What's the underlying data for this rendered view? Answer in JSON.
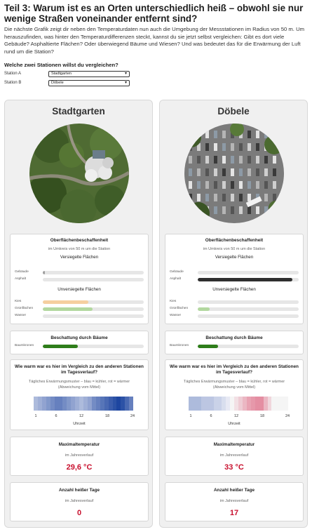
{
  "header": {
    "title": "Teil 3: Warum ist es an Orten unterschiedlich heiß – obwohl sie nur wenige Straßen voneinander entfernt sind?",
    "intro": "Die nächste Grafik zeigt dir neben den Temperaturdaten nun auch die Umgebung der Messstationen im Radius von 50 m. Um herauszufinden, was hinter den Temperaturdifferenzen steckt, kannst du sie jetzt selbst vergleichen: Gibt es dort viele Gebäude? Asphaltierte Flächen? Oder überwiegend Bäume und Wiesen? Und was bedeutet das für die Erwärmung der Luft rund um die Station?"
  },
  "selector": {
    "question": "Welche zwei Stationen willst du vergleichen?",
    "station_a_label": "Station A",
    "station_a_value": "Stadtgarten",
    "station_b_label": "Station B",
    "station_b_value": "Döbele"
  },
  "labels": {
    "surface_title": "Oberflächenbeschaffenheit",
    "surface_sub": "im Umkreis von 50 m um die Station",
    "sealed_title": "Versiegelte Flächen",
    "unsealed_title": "Unversiegelte Flächen",
    "building": "Gebäude",
    "asphalt": "Asphalt",
    "gravel": "Kies",
    "green": "Grünflächen",
    "water": "Wasser",
    "shade_title": "Beschattung durch Bäume",
    "canopy": "Baumkronen",
    "compare_title": "Wie warm war es hier im Vergleich zu den anderen Stationen im Tagesverlauf?",
    "compare_sub": "Tägliches Erwärmungsmuster – blau = kühler, rot = wärmer (Abweichung vom Mittel)",
    "hour_ticks": [
      "1",
      "6",
      "12",
      "18",
      "24"
    ],
    "hour_axis": "Uhrzeit",
    "max_title": "Maximaltemperatur",
    "max_sub": "im Jahresverlauf",
    "hot_title": "Anzahl heißer Tage",
    "hot_sub": "im Jahresverlauf"
  },
  "colors": {
    "building": "#9e9e9e",
    "asphalt": "#2f2f2f",
    "gravel": "#f5cfa0",
    "green": "#b3d8a0",
    "canopy": "#2e7d1a",
    "value_red": "#c8102e"
  },
  "stations": [
    {
      "name": "Stadtgarten",
      "surface": {
        "building": 0.02,
        "asphalt": 0.0,
        "gravel": 0.45,
        "green": 0.49,
        "water": 0.0
      },
      "canopy": 0.35,
      "hourly_deviation": [
        -0.5,
        -0.6,
        -0.7,
        -0.8,
        -0.9,
        -1.0,
        -1.0,
        -0.9,
        -0.8,
        -0.7,
        -0.6,
        -0.5,
        -0.6,
        -0.7,
        -0.9,
        -1.0,
        -1.1,
        -1.2,
        -1.3,
        -1.4,
        -1.5,
        -1.4,
        -1.2,
        -1.0
      ],
      "max_temp": "29,6 °C",
      "hot_days": "0"
    },
    {
      "name": "Döbele",
      "surface": {
        "building": 0.0,
        "asphalt": 0.94,
        "gravel": 0.0,
        "green": 0.12,
        "water": 0.0
      },
      "canopy": 0.2,
      "hourly_deviation": [
        -0.5,
        -0.5,
        -0.5,
        -0.4,
        -0.4,
        -0.4,
        -0.3,
        -0.3,
        -0.2,
        -0.1,
        0.0,
        0.2,
        0.4,
        0.6,
        0.8,
        0.9,
        1.0,
        1.0,
        0.6,
        0.3,
        0.0,
        0.0,
        0.0,
        0.0
      ],
      "max_temp": "33 °C",
      "hot_days": "17"
    }
  ]
}
